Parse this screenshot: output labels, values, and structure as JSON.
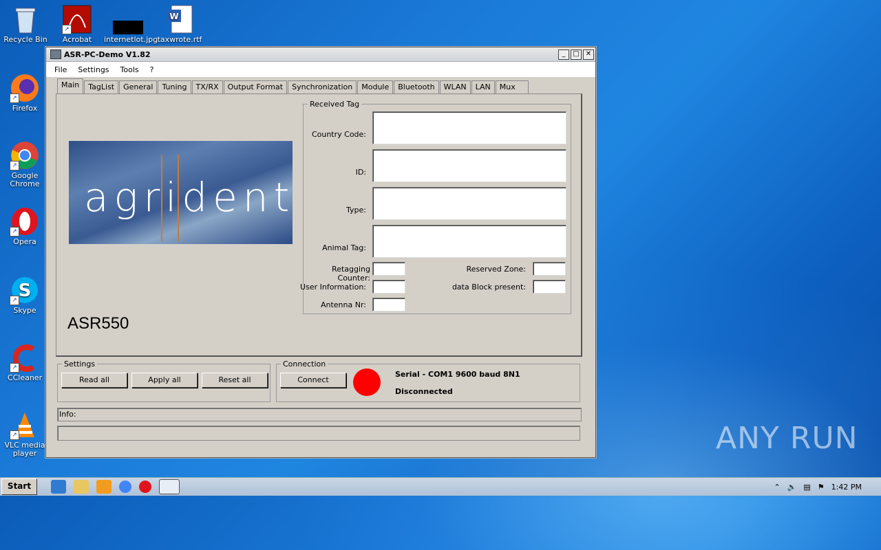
{
  "desktop": {
    "icons": [
      {
        "label": "Recycle Bin"
      },
      {
        "label": "Firefox"
      },
      {
        "label": "Google Chrome"
      },
      {
        "label": "Opera"
      },
      {
        "label": "Skype"
      },
      {
        "label": "CCleaner"
      },
      {
        "label": "VLC media player"
      },
      {
        "label": "Acrobat"
      },
      {
        "label": "internetlot.jpg"
      },
      {
        "label": "taxwrote.rtf"
      }
    ],
    "watermark": "ANY RUN"
  },
  "window": {
    "title": "ASR-PC-Demo V1.82",
    "controls": {
      "minimize": "_",
      "maximize": "□",
      "close": "✕"
    },
    "menu": [
      "File",
      "Settings",
      "Tools",
      "?"
    ],
    "tabs": [
      "Main",
      "TagList",
      "General",
      "Tuning",
      "TX/RX",
      "Output Format",
      "Synchronization",
      "Module",
      "Bluetooth",
      "WLAN",
      "LAN",
      "Mux"
    ],
    "active_tab": "Main",
    "logo_text": "agrident",
    "model": "ASR550",
    "received_tag": {
      "legend": "Received Tag",
      "country_code_label": "Country Code:",
      "id_label": "ID:",
      "type_label": "Type:",
      "animal_tag_label": "Animal Tag:",
      "retagging_counter_label": "Retagging Counter:",
      "user_information_label": "User Information:",
      "antenna_nr_label": "Antenna Nr:",
      "reserved_zone_label": "Reserved Zone:",
      "data_block_label": "data Block present:"
    },
    "settings": {
      "legend": "Settings",
      "read_all": "Read all",
      "apply_all": "Apply all",
      "reset_all": "Reset all"
    },
    "connection": {
      "legend": "Connection",
      "connect": "Connect",
      "port_info": "Serial - COM1 9600 baud 8N1",
      "status": "Disconnected",
      "status_color": "#ff0000"
    },
    "info_label": "Info:"
  },
  "taskbar": {
    "start": "Start",
    "clock": "1:42 PM"
  }
}
